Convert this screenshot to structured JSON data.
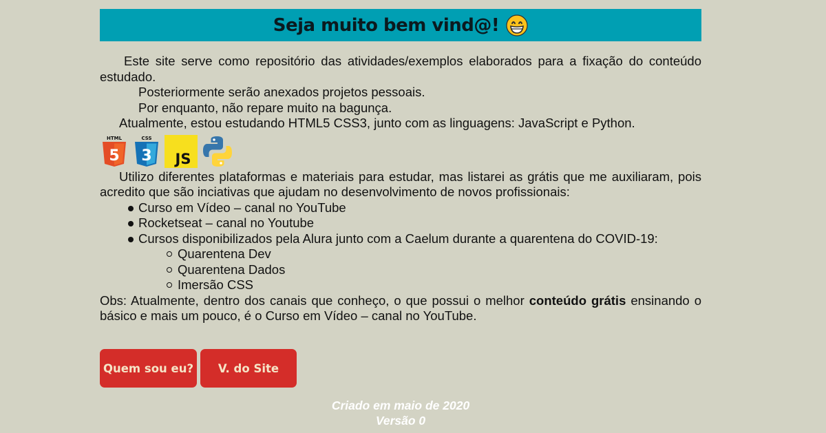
{
  "header": {
    "title": "Seja muito bem vind@!",
    "emoji_icon": "grinning-face-icon"
  },
  "intro": {
    "line1": "Este site serve como repositório das atividades/exemplos elaborados para a fixação do conteúdo estudado.",
    "line2": "Posteriormente serão anexados projetos pessoais.",
    "line3": "Por enquanto, não repare muito na bagunça.",
    "line4": "Atualmente, estou estudando HTML5 CSS3, junto com as linguagens: JavaScript e Python."
  },
  "tech_icons": [
    {
      "name": "html5-icon",
      "label": "HTML",
      "badge": "5",
      "color": "#e44d26"
    },
    {
      "name": "css3-icon",
      "label": "CSS",
      "badge": "3",
      "color": "#1572b6"
    },
    {
      "name": "javascript-icon",
      "badge": "JS",
      "color": "#f7df1e"
    },
    {
      "name": "python-icon",
      "colors": [
        "#3776ab",
        "#ffd43b"
      ]
    }
  ],
  "platforms": {
    "intro": "Utilizo diferentes plataformas e materiais para estudar, mas listarei as grátis que me auxiliaram, pois acredito que são inciativas que ajudam no desenvolvimento de novos profissionais:",
    "items": [
      "Curso em Vídeo – canal no YouTube",
      "Rocketseat – canal no Youtube",
      "Cursos disponibilizados pela Alura junto com a Caelum durante a quarentena do COVID-19:"
    ],
    "sub_items": [
      "Quarentena Dev",
      "Quarentena Dados",
      "Imersão CSS"
    ]
  },
  "obs": {
    "before": "Obs: Atualmente, dentro dos canais que conheço, o que possui o melhor ",
    "bold": "conteúdo grátis",
    "after": " ensinando o básico e mais um pouco, é o Curso em Vídeo – canal no YouTube."
  },
  "buttons": {
    "about": "Quem sou eu?",
    "version": "V. do Site"
  },
  "footer": {
    "created": "Criado em maio de 2020",
    "version": "Versão 0"
  },
  "colors": {
    "background": "#d3d3c4",
    "title_bar": "#009fb3",
    "button": "#d42d29",
    "button_text": "#f5e4c6"
  }
}
